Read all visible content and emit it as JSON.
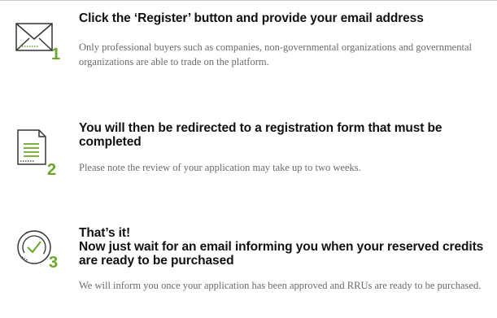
{
  "steps": [
    {
      "number": "1",
      "icon": "envelope-icon",
      "title": "Click the ‘Register’ button and provide your email address",
      "description": "Only professional buyers such as companies, non-governmental organizations and governmental organizations are able to trade on the platform."
    },
    {
      "number": "2",
      "icon": "document-icon",
      "title": "You will then be redirected to a registration form that must be completed",
      "description": "Please note the review of your application may take up to two weeks."
    },
    {
      "number": "3",
      "icon": "check-circle-icon",
      "title_line1": "That’s it!",
      "title_line2": "Now just wait for an email informing you when your reserved credits are ready to be purchased",
      "description": "We will inform you once your application has been approved and RRUs are ready to be purchased."
    }
  ],
  "colors": {
    "accent": "#6aa629",
    "title": "#111111",
    "description": "#6b6b6b",
    "icon_stroke": "#333333"
  }
}
